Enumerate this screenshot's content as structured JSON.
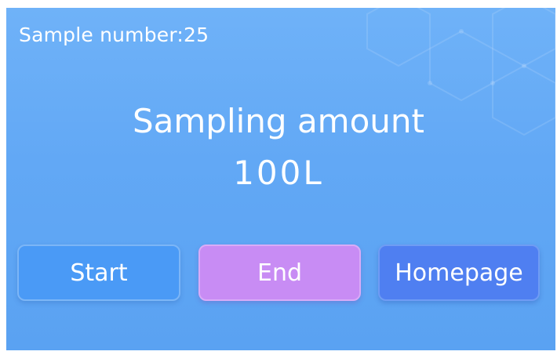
{
  "status": {
    "sample_number_label": "Sample number:25"
  },
  "main": {
    "title": "Sampling amount",
    "value": "100L"
  },
  "buttons": {
    "start_label": "Start",
    "end_label": "End",
    "home_label": "Homepage"
  },
  "colors": {
    "background": "#62a8f5",
    "start_button": "#4a9af6",
    "end_button": "#c88cf4",
    "home_button": "#4f7ff1",
    "text": "#ffffff"
  }
}
